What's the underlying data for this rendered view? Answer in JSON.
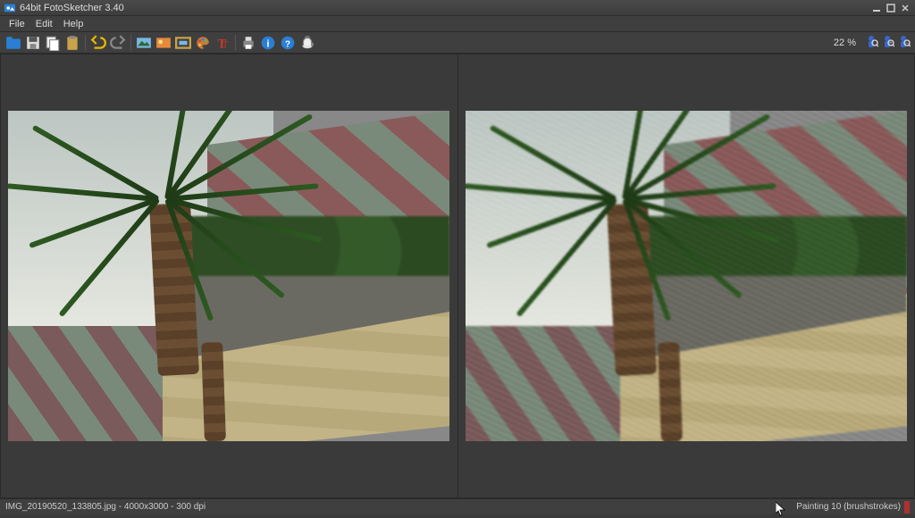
{
  "title": "64bit FotoSketcher 3.40",
  "menu": {
    "file": "File",
    "edit": "Edit",
    "help": "Help"
  },
  "toolbar": {
    "open": "open",
    "save": "save",
    "copy": "copy",
    "paste": "paste",
    "undo": "undo",
    "redo": "redo",
    "draw_params": "draw-params",
    "retouch": "retouch",
    "frame": "frame",
    "palette": "palette",
    "text": "text",
    "print": "print",
    "info": "info",
    "about": "about",
    "donate": "donate"
  },
  "zoom_label": "22 %",
  "helpers": {
    "h1": "helper-1",
    "h2": "helper-2",
    "h3": "helper-3"
  },
  "status": {
    "file_info": "IMG_20190520_133805.jpg - 4000x3000 - 300 dpi",
    "effect": "Painting 10 (brushstrokes)"
  },
  "colors": {
    "bg": "#3a3a3a",
    "panel": "#3f3f3f",
    "accent_open": "#2a7fd4",
    "accent_undo": "#e6b800",
    "accent_text": "#c83a2a"
  }
}
